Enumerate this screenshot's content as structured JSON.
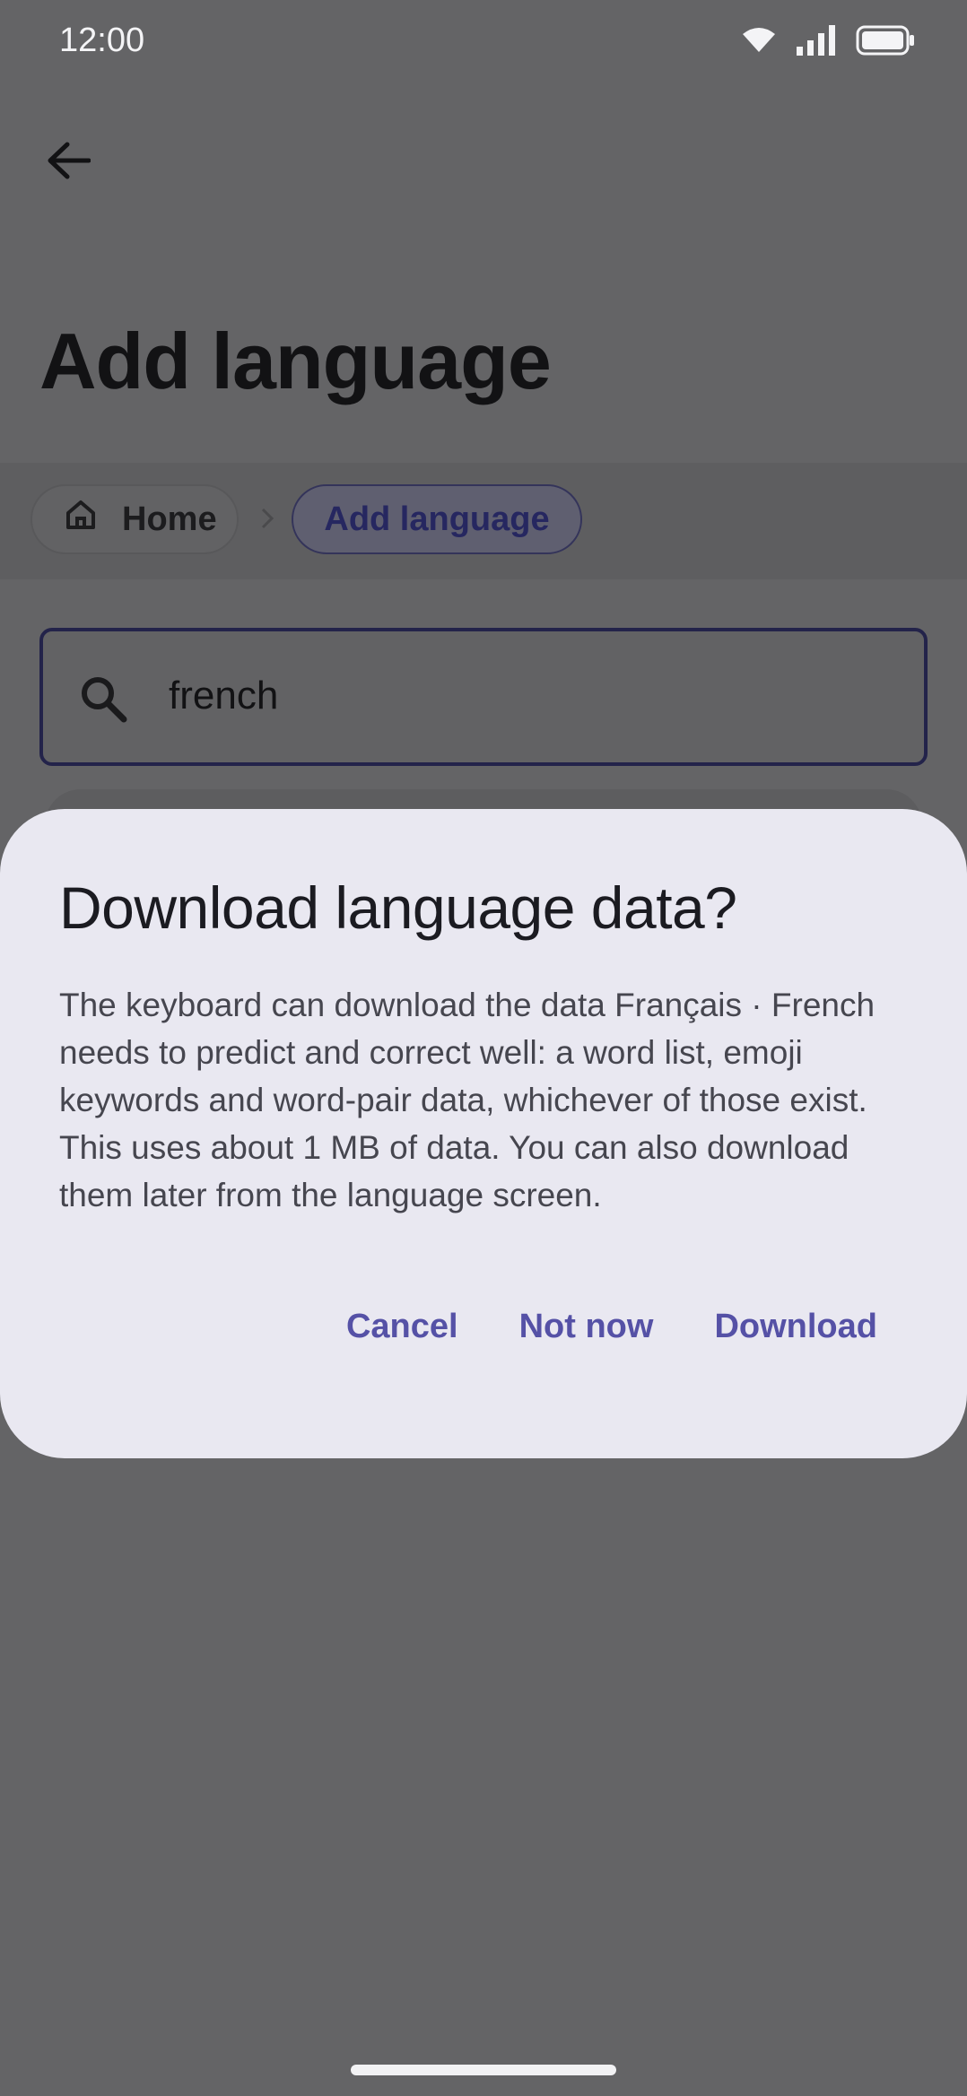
{
  "status_bar": {
    "time": "12:00",
    "icons": [
      "wifi-icon",
      "signal-icon",
      "battery-icon"
    ]
  },
  "top_bar": {
    "back_icon": "arrow-left-icon"
  },
  "page": {
    "title": "Add language"
  },
  "breadcrumb": {
    "home_label": "Home",
    "current_label": "Add language"
  },
  "search": {
    "value": "french",
    "placeholder": ""
  },
  "dialog": {
    "title": "Download language data?",
    "body": "The keyboard can download the data Français · French needs to predict and correct well: a word list, emoji keywords and word-pair data, whichever of those exist. This uses about 1 MB of data. You can also download them later from the language screen.",
    "actions": {
      "cancel": "Cancel",
      "not_now": "Not now",
      "download": "Download"
    }
  },
  "colors": {
    "accent": "#5551a6",
    "scrim": "#646466",
    "dialog_surface": "#e9e8f1"
  }
}
